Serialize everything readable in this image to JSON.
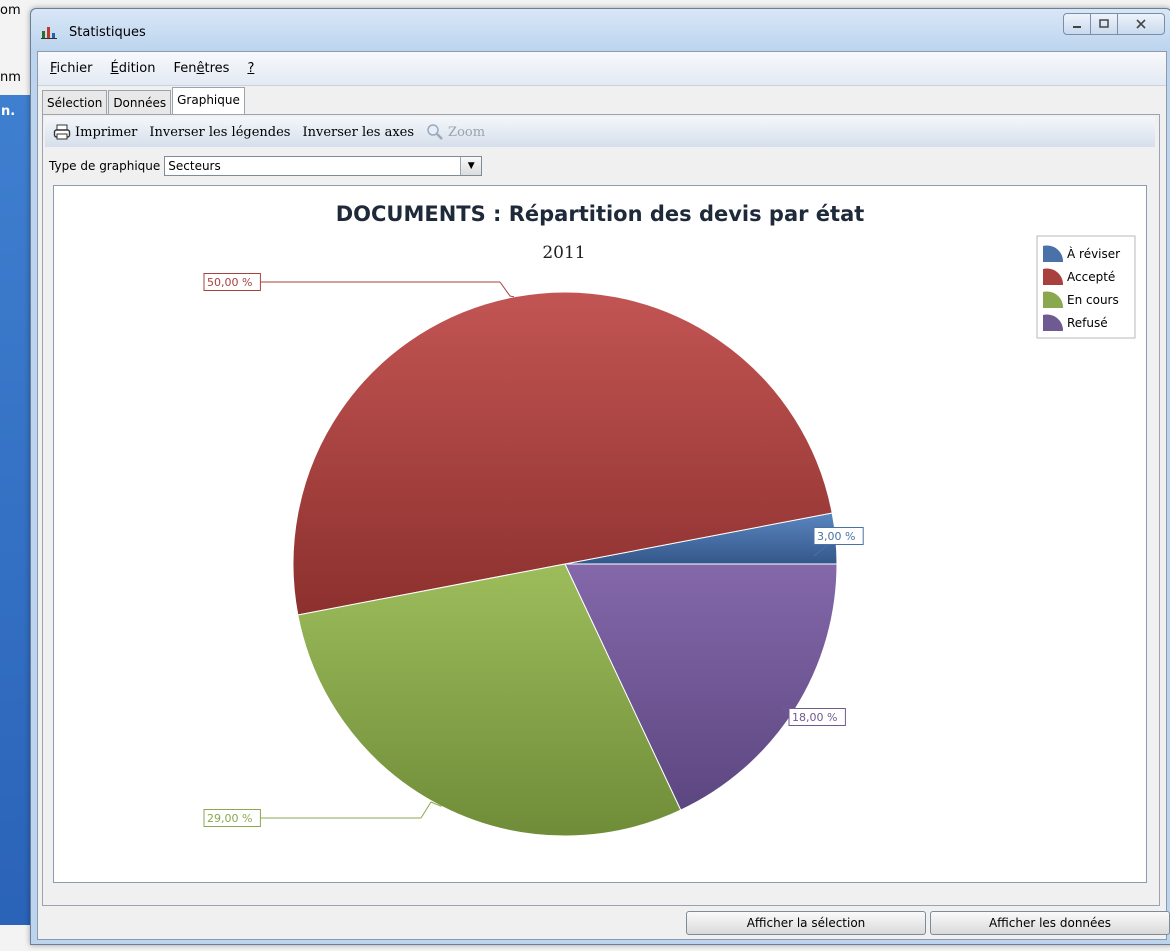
{
  "background": {
    "left_text_top": "om",
    "left_text_2": "nm",
    "left_text_3": "n."
  },
  "window": {
    "title": "Statistiques"
  },
  "menu": [
    {
      "label": "Fichier"
    },
    {
      "label": "Édition"
    },
    {
      "label": "Fenêtres"
    },
    {
      "label": "?"
    }
  ],
  "tabs": [
    {
      "label": "Sélection",
      "active": false
    },
    {
      "label": "Données",
      "active": false
    },
    {
      "label": "Graphique",
      "active": true
    }
  ],
  "toolbar": {
    "print_label": "Imprimer",
    "invert_legends_label": "Inverser les légendes",
    "invert_axes_label": "Inverser les axes",
    "zoom_label": "Zoom"
  },
  "chart_type": {
    "label": "Type de graphique",
    "value": "Secteurs"
  },
  "footer": {
    "show_selection_label": "Afficher la sélection",
    "show_data_label": "Afficher les données"
  },
  "chart_data": {
    "type": "pie",
    "title": "DOCUMENTS : Répartition des devis par état",
    "subtitle": "2011",
    "legend_position": "top-right",
    "series": [
      {
        "name": "À réviser",
        "value": 3.0,
        "label": "3,00 %",
        "color": "#4a72a8"
      },
      {
        "name": "Accepté",
        "value": 50.0,
        "label": "50,00 %",
        "color": "#a8403e"
      },
      {
        "name": "En cours",
        "value": 29.0,
        "label": "29,00 %",
        "color": "#8aa84e"
      },
      {
        "name": "Refusé",
        "value": 18.0,
        "label": "18,00 %",
        "color": "#6f5a92"
      }
    ]
  }
}
